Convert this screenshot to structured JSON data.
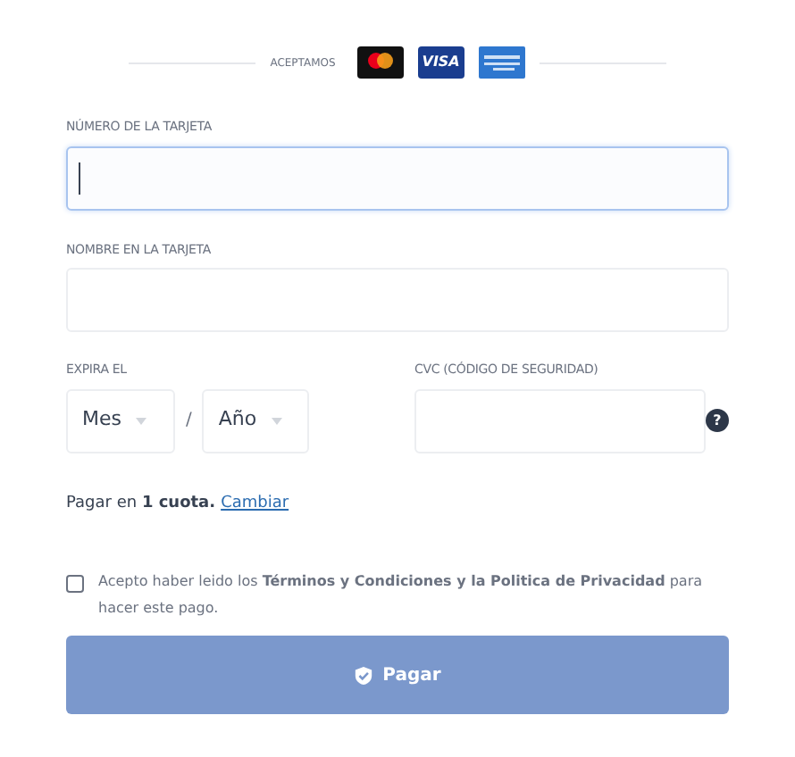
{
  "accepted": {
    "label": "ACEPTAMOS",
    "cards": [
      {
        "kind": "mastercard"
      },
      {
        "kind": "visa",
        "text": "VISA"
      },
      {
        "kind": "amex"
      }
    ]
  },
  "card_number": {
    "label": "NÚMERO DE LA TARJETA",
    "focused": true
  },
  "card_name": {
    "label": "NOMBRE EN LA TARJETA",
    "focused": false
  },
  "expiry": {
    "label": "EXPIRA EL",
    "month": "Mes",
    "separator": "/",
    "year": "Año"
  },
  "cvc": {
    "label": "CVC (CÓDIGO DE SEGURIDAD)",
    "help": "?"
  },
  "installments": {
    "text": "Pagar en **1 cuota.**",
    "link": "Cambiar"
  },
  "terms": {
    "checked": false,
    "text": "Acepto haber leido los **Términos y Condiciones y la Politica de Privacidad** para hacer este pago."
  },
  "pay_button": {
    "label": "Pagar",
    "disabled": true
  }
}
